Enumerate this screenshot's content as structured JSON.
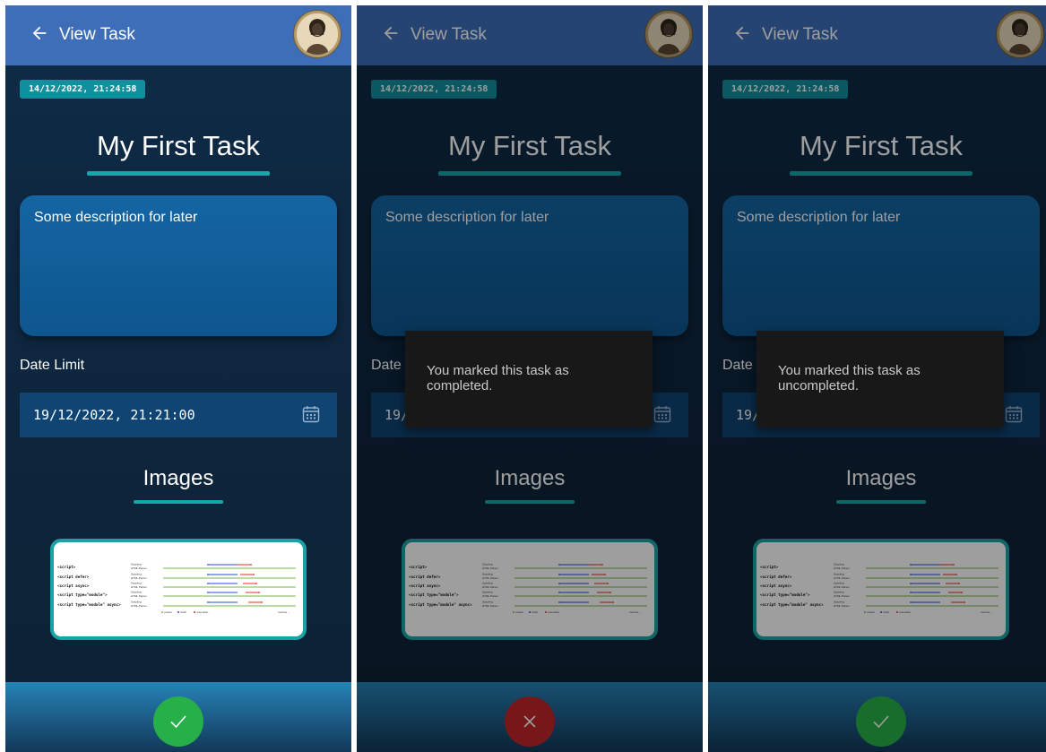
{
  "colors": {
    "appbar": "#3e6eb8",
    "background": "#0f2840",
    "accent": "#14a8a8",
    "description_box": "#1465a3",
    "date_field": "#0f4473",
    "complete_fab": "#27b04a",
    "uncomplete_fab": "#c0262a",
    "snackbar": "#181818"
  },
  "icons": {
    "back": "arrow-left-icon",
    "calendar": "calendar-icon",
    "check": "check-icon",
    "close": "close-icon"
  },
  "panels": [
    {
      "appbar_title": "View Task",
      "created_at": "14/12/2022, 21:24:58",
      "title": "My First Task",
      "description": "Some description for later",
      "date_limit_label": "Date Limit",
      "date_limit_value": "19/12/2022, 21:21:00",
      "images_heading": "Images",
      "fab_icon": "check-icon",
      "fab_color": "#27b04a",
      "snackbar": ""
    },
    {
      "appbar_title": "View Task",
      "created_at": "14/12/2022, 21:24:58",
      "title": "My First Task",
      "description": "Some description for later",
      "date_limit_label": "Date Limit",
      "date_limit_value": "19/12/2022, 21:21:00",
      "images_heading": "Images",
      "fab_icon": "close-icon",
      "fab_color": "#c0262a",
      "snackbar": "You marked this task as completed."
    },
    {
      "appbar_title": "View Task",
      "created_at": "14/12/2022, 21:24:58",
      "title": "My First Task",
      "description": "Some description for later",
      "date_limit_label": "Date Limit",
      "date_limit_value": "19/12/2022, 21:21:00",
      "images_heading": "Images",
      "fab_icon": "check-icon",
      "fab_color": "#27b04a",
      "snackbar": "You marked this task as uncompleted."
    }
  ],
  "thumbnail": {
    "rows": [
      "<script>",
      "<script defer>",
      "<script async>",
      "<script type=\"module\">",
      "<script type=\"module\" async>"
    ],
    "lane_labels": [
      "Scripting",
      "HTML Parser"
    ],
    "legend": [
      "parser",
      "fetch",
      "execution"
    ],
    "runtime_label": "runtime →"
  }
}
